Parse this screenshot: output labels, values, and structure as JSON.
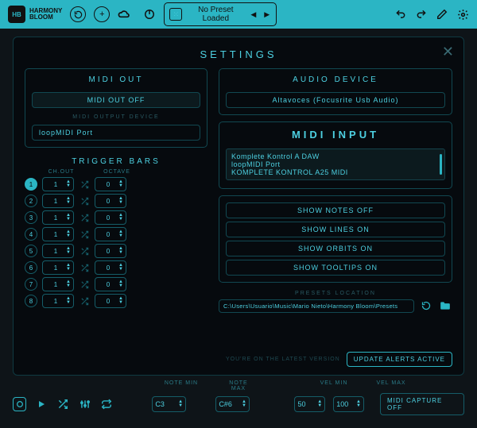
{
  "brand": {
    "badge": "HB",
    "line1": "HARMONY",
    "line2": "BLOOM"
  },
  "preset_strip": {
    "label": "No Preset Loaded"
  },
  "modal": {
    "title": "SETTINGS",
    "midi_out": {
      "title": "MIDI OUT",
      "toggle": "MIDI OUT OFF",
      "device_label": "MIDI OUTPUT DEVICE",
      "device": "loopMIDI Port"
    },
    "trigger_bars": {
      "title": "TRIGGER BARS",
      "head_ch": "CH.OUT",
      "head_oct": "OCTAVE",
      "rows": [
        {
          "n": "1",
          "ch": "1",
          "oct": "0",
          "active": true
        },
        {
          "n": "2",
          "ch": "1",
          "oct": "0",
          "active": false
        },
        {
          "n": "3",
          "ch": "1",
          "oct": "0",
          "active": false
        },
        {
          "n": "4",
          "ch": "1",
          "oct": "0",
          "active": false
        },
        {
          "n": "5",
          "ch": "1",
          "oct": "0",
          "active": false
        },
        {
          "n": "6",
          "ch": "1",
          "oct": "0",
          "active": false
        },
        {
          "n": "7",
          "ch": "1",
          "oct": "0",
          "active": false
        },
        {
          "n": "8",
          "ch": "1",
          "oct": "0",
          "active": false
        }
      ]
    },
    "audio_device": {
      "title": "AUDIO DEVICE",
      "value": "Altavoces (Focusrite Usb Audio)"
    },
    "midi_input": {
      "title": "MIDI INPUT",
      "items": [
        "Komplete Kontrol A DAW",
        "loopMIDI Port",
        "KOMPLETE KONTROL A25 MIDI"
      ]
    },
    "display_toggles": {
      "notes": "SHOW NOTES OFF",
      "lines": "SHOW LINES ON",
      "orbits": "SHOW ORBITS ON",
      "tooltips": "SHOW TOOLTIPS ON"
    },
    "presets": {
      "title": "PRESETS LOCATION",
      "path": "C:\\Users\\Usuario\\Music\\Mario Nieto\\Harmony Bloom\\Presets"
    },
    "footer": {
      "version": "YOU'RE ON THE LATEST VERSION",
      "update_btn": "UPDATE ALERTS ACTIVE"
    }
  },
  "bottom": {
    "labels": {
      "note_min": "NOTE MIN",
      "note_max": "NOTE MAX",
      "vel_min": "VEL MIN",
      "vel_max": "VEL MAX"
    },
    "note_min": "C3",
    "note_max": "C#6",
    "vel_min": "50",
    "vel_max": "100",
    "capture": "MIDI CAPTURE OFF"
  }
}
